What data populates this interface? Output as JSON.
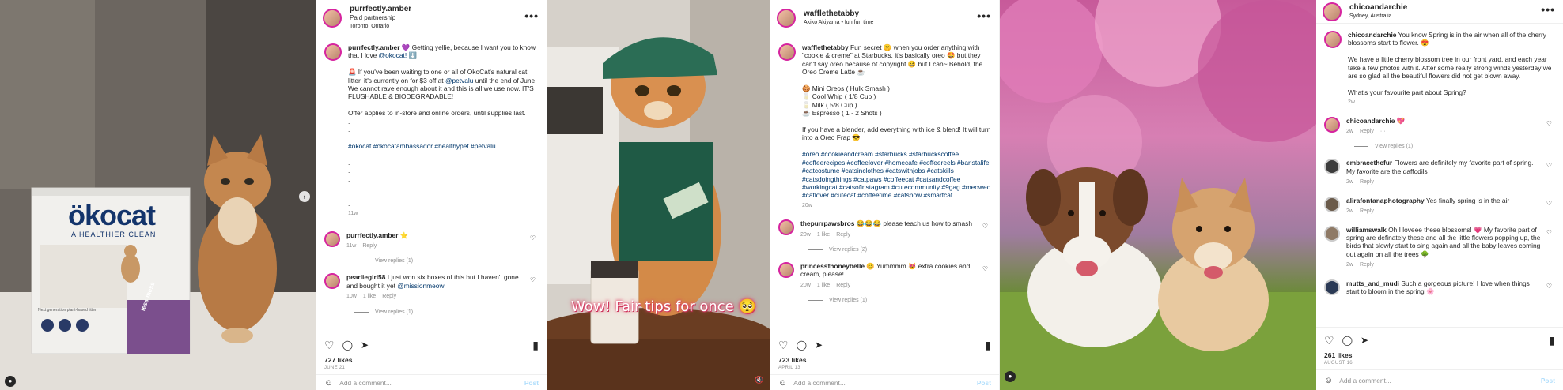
{
  "post1": {
    "username": "purrfectly.amber",
    "subtitle": "Paid partnership",
    "location": "Toronto, Ontario",
    "product_brand": "ökocat",
    "product_tagline": "A HEALTHIER CLEAN",
    "product_badge": "less mess",
    "product_small": "Next generation plant-based litter",
    "caption_user": "purrfectly.amber",
    "caption": "💜 Getting yellie, because I want you to know that I love ",
    "caption_mention": "@okocat! ⬇️",
    "caption_p2a": "🚨 If you've been waiting to one or all of OkoCat's natural cat litter, it's currently on for $3 off at ",
    "caption_p2_mention": "@petvalu",
    "caption_p2b": " until the end of June! We cannot rave enough about it and this is all we use now. IT'S FLUSHABLE & BIODEGRADABLE!",
    "caption_p3": "Offer applies to in-store and online orders, until supplies last.",
    "caption_dots": ".\n.",
    "hashtags": "#okocat #okocatambassador #healthypet #petvalu",
    "caption_dots2": ".\n.\n.\n.\n.\n.\n.",
    "time": "11w",
    "comments": [
      {
        "user": "purrfectly.amber",
        "text": "⭐",
        "time": "11w",
        "likes": "",
        "reply": "Reply",
        "view_replies": "View replies (1)"
      },
      {
        "user": "pearliegirl58",
        "text": "I just won six boxes of this but I haven't gone and bought it yet ",
        "mention": "@missionmeow",
        "time": "10w",
        "likes": "1 like",
        "reply": "Reply",
        "view_replies": "View replies (1)"
      }
    ],
    "likes": "727 likes",
    "date": "JUNE 21",
    "add_comment": "Add a comment...",
    "post": "Post"
  },
  "post2": {
    "overlay_text": "Wow! Fair tips for once 🥺",
    "username": "wafflethetabby",
    "subtitle": "Akiko Akiyama • fun fun time",
    "caption_user": "wafflethetabby",
    "caption_p1": "Fun secret 🤫 when you order anything with \"cookie & creme\" at Starbucks, it's basically oreo 🤩 but they can't say oreo because of copyright 😆 but I can~ Behold, the Oreo Creme Latte ☕",
    "caption_recipe": "🍪 Mini Oreos ( Hulk Smash )\n🥛 Cool Whip ( 1/8 Cup )\n🥛 Milk ( 5/8 Cup )\n☕ Espresso ( 1 - 2 Shots )",
    "caption_p3": "If you have a blender, add everything with ice & blend! It will turn into a Oreo Frap 😎",
    "hashtags": "#oreo #cookieandcream #starbucks #starbuckscoffee #coffeerecipes #coffeelover #homecafe #coffeereels #baristalife #catcostume #catsinclothes #catswithjobs #catskills #catsdoingthings #catpaws #coffeecat #catsandcoffee #workingcat #catsofinstagram #cutecommunity #9gag #meowed #catlover #cutecat #coffeetime #catshow #smartcat",
    "time": "20w",
    "comments": [
      {
        "user": "thepurrpawsbros",
        "text": "😂😂😂 please teach us how to smash",
        "time": "20w",
        "likes": "1 like",
        "reply": "Reply",
        "view_replies": "View replies (2)"
      },
      {
        "user": "princessfhoneybelle",
        "text": "😊 Yummmm 😻 extra cookies and cream, please!",
        "time": "20w",
        "likes": "1 like",
        "reply": "Reply",
        "view_replies": "View replies (1)"
      }
    ],
    "likes": "723 likes",
    "date": "APRIL 13",
    "add_comment": "Add a comment...",
    "post": "Post"
  },
  "post3": {
    "username": "chicoandarchie",
    "subtitle": "Sydney, Australia",
    "caption_user": "chicoandarchie",
    "caption_p1": "You know Spring is in the air when all of the cherry blossoms start to flower. 😍",
    "caption_p2": "We have a little cherry blossom tree in our front yard, and each year take a few photos with it. After some really strong winds yesterday we are so glad all the beautiful flowers did not get blown away.",
    "caption_p3": "What's your favourite part about Spring?",
    "time": "2w",
    "comments": [
      {
        "user": "chicoandarchie",
        "text": "💖",
        "time": "2w",
        "likes": "",
        "reply": "Reply",
        "extra": "···",
        "view_replies": "View replies (1)"
      },
      {
        "user": "embracethefur",
        "text": "Flowers are definitely my favorite part of spring. My favorite are the daffodils",
        "time": "2w",
        "likes": "",
        "reply": "Reply"
      },
      {
        "user": "alirafontanaphotography",
        "text": "Yes finally spring is in the air",
        "time": "2w",
        "likes": "",
        "reply": "Reply"
      },
      {
        "user": "williamswalk",
        "text": "Oh I loveee these blossoms! 💗 My favorite part of spring are definately these and all the little flowers popping up, the birds that slowly start to sing again and all the baby leaves coming out again on all the trees 🌳",
        "time": "2w",
        "likes": "",
        "reply": "Reply"
      },
      {
        "user": "mutts_and_mudi",
        "text": "Such a gorgeous picture! I love when things start to bloom in the spring 🌸",
        "time": "",
        "likes": "",
        "reply": ""
      }
    ],
    "likes": "261 likes",
    "date": "AUGUST 16",
    "add_comment": "Add a comment...",
    "post": "Post"
  },
  "icons": {
    "heart": "♡",
    "comment": "◯",
    "share": "➤",
    "bookmark": "▮",
    "more": "•••",
    "next": "›",
    "smile": "☺",
    "user": "●",
    "mute": "🔇"
  },
  "colors": {
    "link": "#00376b",
    "meta": "#8e8e8e",
    "post_disabled": "#b2dffc",
    "ring": "#d6249f"
  }
}
